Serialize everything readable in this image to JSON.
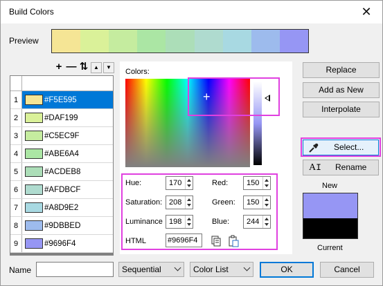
{
  "window": {
    "title": "Build Colors",
    "close_glyph": "✕"
  },
  "preview": {
    "label": "Preview",
    "colors": [
      "#F5E595",
      "#DAF199",
      "#C5EC9F",
      "#ABE6A4",
      "#ACDEB8",
      "#AFDBCF",
      "#A8D9E2",
      "#9DBBED",
      "#9696F4"
    ]
  },
  "toolbar": {
    "add_glyph": "+",
    "remove_glyph": "—",
    "sort_glyph": "⇅",
    "up_glyph": "▲",
    "down_glyph": "▼"
  },
  "list": {
    "rows": [
      {
        "num": "1",
        "hex": "#F5E595",
        "color": "#F5E595"
      },
      {
        "num": "2",
        "hex": "#DAF199",
        "color": "#DAF199"
      },
      {
        "num": "3",
        "hex": "#C5EC9F",
        "color": "#C5EC9F"
      },
      {
        "num": "4",
        "hex": "#ABE6A4",
        "color": "#ABE6A4"
      },
      {
        "num": "5",
        "hex": "#ACDEB8",
        "color": "#ACDEB8"
      },
      {
        "num": "6",
        "hex": "#AFDBCF",
        "color": "#AFDBCF"
      },
      {
        "num": "7",
        "hex": "#A8D9E2",
        "color": "#A8D9E2"
      },
      {
        "num": "8",
        "hex": "#9DBBED",
        "color": "#9DBBED"
      },
      {
        "num": "9",
        "hex": "#9696F4",
        "color": "#9696F4"
      }
    ]
  },
  "picker": {
    "colors_label": "Colors:",
    "hue": {
      "label": "Hue:",
      "value": "170"
    },
    "saturation": {
      "label": "Saturation:",
      "value": "208"
    },
    "luminance": {
      "label": "Luminance",
      "value": "198"
    },
    "red": {
      "label": "Red:",
      "value": "150"
    },
    "green": {
      "label": "Green:",
      "value": "150"
    },
    "blue": {
      "label": "Blue:",
      "value": "244"
    },
    "html": {
      "label": "HTML",
      "value": "#9696F4"
    }
  },
  "buttons": {
    "replace": "Replace",
    "add_as_new": "Add as New",
    "interpolate": "Interpolate",
    "select": "Select...",
    "rename": "Rename",
    "ok": "OK",
    "cancel": "Cancel"
  },
  "swatches": {
    "new_label": "New",
    "current_label": "Current",
    "new_color": "#9696F4",
    "current_color": "#000000"
  },
  "footer": {
    "name_label": "Name",
    "name_value": "",
    "mode_select": "Sequential",
    "type_select": "Color List"
  },
  "colors": {
    "accent": "#0078D7",
    "highlight": "#E040E0"
  }
}
